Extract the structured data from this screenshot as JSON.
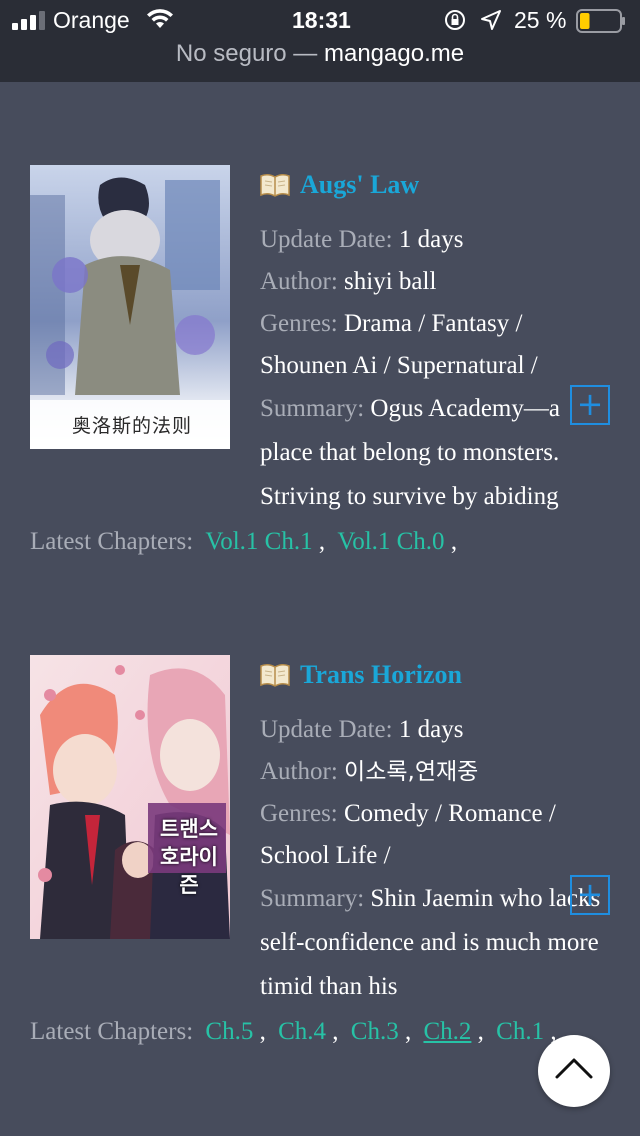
{
  "status_bar": {
    "carrier": "Orange",
    "time": "18:31",
    "battery_percent": "25 %",
    "battery_level": 0.25
  },
  "url_bar": {
    "prefix": "No seguro —",
    "domain": "mangago.me"
  },
  "labels": {
    "update_date": "Update Date:",
    "author": "Author:",
    "genres": "Genres:",
    "summary": "Summary:",
    "latest_chapters": "Latest Chapters:",
    "plus": "+"
  },
  "entries": [
    {
      "title": "Augs' Law",
      "update_date": "1 days",
      "author": "shiyi ball",
      "genres": "Drama / Fantasy / Shounen Ai / Supernatural /",
      "summary": "Ogus Academy—a place that belong to monsters. Striving to survive by abiding",
      "chapters": [
        "Vol.1 Ch.1",
        "Vol.1 Ch.0"
      ],
      "cover_text": "奥洛斯的法则"
    },
    {
      "title": "Trans Horizon",
      "update_date": "1 days",
      "author": "이소록,연재중",
      "genres": "Comedy / Romance / School Life /",
      "summary": "Shin Jaemin who lacks self-confidence and is much more timid than his",
      "chapters": [
        "Ch.5",
        "Ch.4",
        "Ch.3",
        "Ch.2",
        "Ch.1"
      ],
      "cover_text": "트랜스 호라이즌"
    }
  ],
  "colors": {
    "background": "#474c5c",
    "title": "#1aa7d8",
    "chapter_link": "#27c2a6",
    "label": "#a9adb7"
  }
}
